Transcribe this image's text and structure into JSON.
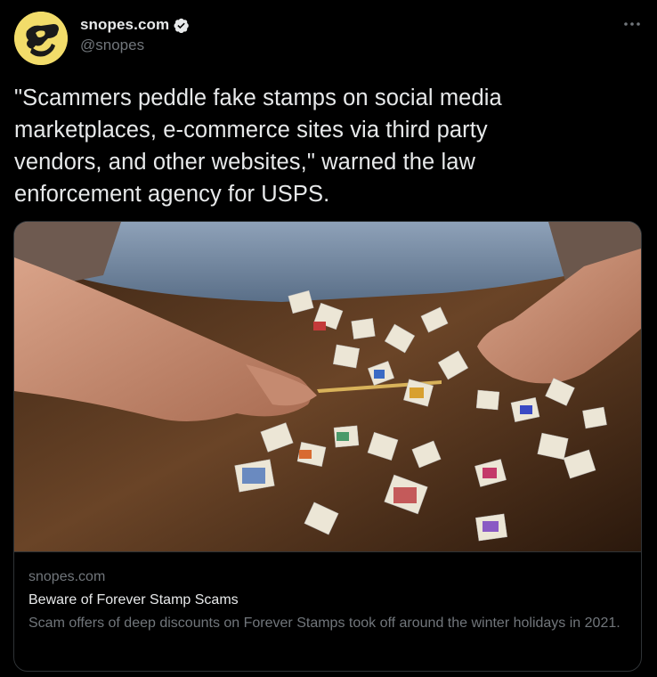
{
  "author": {
    "display_name": "snopes.com",
    "handle": "@snopes",
    "verified": true,
    "avatar_icon": "snopes-logo-icon",
    "avatar_bg": "#f2dc6a"
  },
  "more_icon": "ellipsis-icon",
  "tweet": {
    "text": "\"Scammers peddle fake stamps on social media\nmarketplaces, e-commerce sites via third party\nvendors, and other websites,\" warned the law\nenforcement agency for USPS."
  },
  "card": {
    "image_description_icon": "stamps-photo",
    "domain": "snopes.com",
    "title": "Beware of Forever Stamp Scams",
    "description": "Scam offers of deep discounts on Forever Stamps took off around the winter holidays in 2021."
  },
  "colors": {
    "background": "#000000",
    "primary_text": "#e7e9ea",
    "secondary_text": "#71767b",
    "border": "#2f3336",
    "verified_badge": "#e7e9ea"
  }
}
